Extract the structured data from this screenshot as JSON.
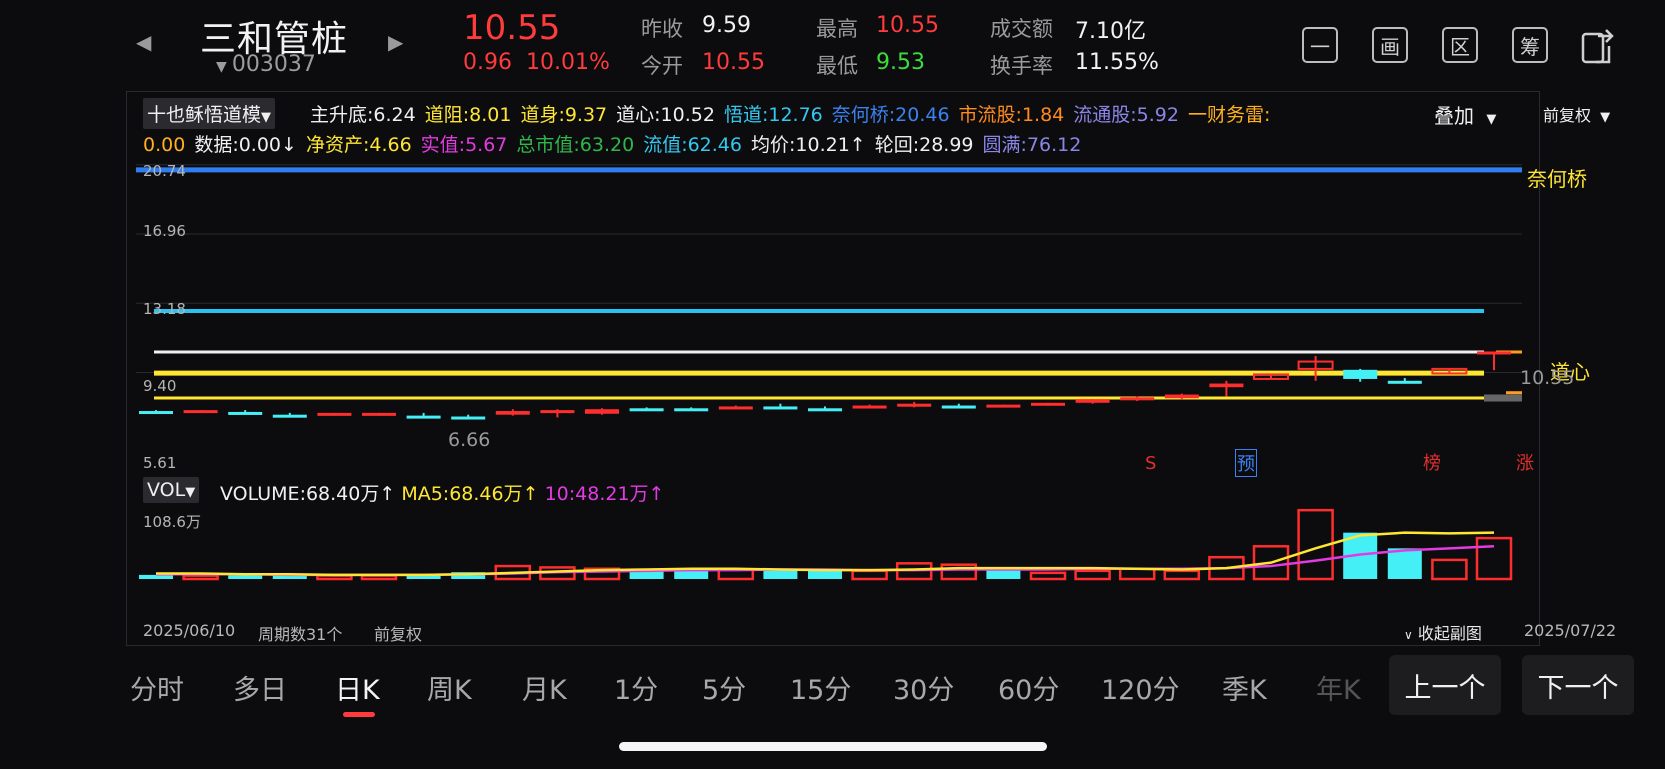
{
  "header": {
    "prev_icon": "chevron-left-icon",
    "next_icon": "chevron-right-icon",
    "stock_name": "三和管桩",
    "stock_code": "003037",
    "price": "10.55",
    "change": "0.96",
    "change_pct": "10.01%",
    "quotes": {
      "prev_close_label": "昨收",
      "prev_close": "9.59",
      "open_label": "今开",
      "open": "10.55",
      "high_label": "最高",
      "high": "10.55",
      "low_label": "最低",
      "low": "9.53",
      "amount_label": "成交额",
      "amount": "7.10亿",
      "turnover_label": "换手率",
      "turnover": "11.55%"
    },
    "tools": [
      "一",
      "画",
      "区",
      "筹"
    ],
    "share_icon": "share-icon"
  },
  "indicator": {
    "selector": "十也稣悟道模",
    "overlay": "叠加",
    "adjust": "前复权",
    "items": [
      {
        "text": "主升底:6.24",
        "color": "#f0f0f0"
      },
      {
        "text": "道阻:8.01",
        "color": "#ffe633"
      },
      {
        "text": "道身:9.37",
        "color": "#ffe633"
      },
      {
        "text": "道心:10.52",
        "color": "#f0f0f0"
      },
      {
        "text": "悟道:12.76",
        "color": "#34c8f0"
      },
      {
        "text": "奈何桥:20.46",
        "color": "#3a82f0"
      },
      {
        "text": "市流股:1.84",
        "color": "#ff8a1f"
      },
      {
        "text": "流通股:5.92",
        "color": "#8a86e8"
      },
      {
        "text": "一财务雷:",
        "color": "#ffb01f"
      }
    ],
    "items2": [
      {
        "text": "0.00",
        "color": "#ffb01f"
      },
      {
        "text": "数据:0.00↓",
        "color": "#f0f0f0"
      },
      {
        "text": "净资产:4.66",
        "color": "#ffe633"
      },
      {
        "text": "实值:5.67",
        "color": "#e23be2"
      },
      {
        "text": "总市值:63.20",
        "color": "#2fb84a"
      },
      {
        "text": "流值:62.46",
        "color": "#34c8f0"
      },
      {
        "text": "均价:10.21↑",
        "color": "#f0f0f0"
      },
      {
        "text": "轮回:28.99",
        "color": "#f0f0f0"
      },
      {
        "text": "圆满:76.12",
        "color": "#8a86e8"
      }
    ]
  },
  "price_chart": {
    "y_ticks": [
      "20.74",
      "16.96",
      "13.18",
      "9.40",
      "5.61"
    ],
    "label_naihe": "奈何桥",
    "label_daoxin": "道心",
    "last_price_label": "10.55",
    "min_label": "6.66",
    "markers": [
      {
        "text": "S",
        "color": "#e0302e"
      },
      {
        "text": "预",
        "color": "#3a82f0"
      },
      {
        "text": "榜",
        "color": "#e0302e"
      },
      {
        "text": "涨",
        "color": "#e0302e"
      }
    ]
  },
  "volume": {
    "selector": "VOL",
    "vol_label": "VOLUME:68.40万↑",
    "ma5_label": "MA5:68.46万↑",
    "ma10_label": "10:48.21万↑",
    "max_label": "108.6万"
  },
  "footer": {
    "start_date": "2025/06/10",
    "period_count": "周期数31个",
    "adjust": "前复权",
    "collapse": "收起副图",
    "end_date": "2025/07/22"
  },
  "tabs": [
    "分时",
    "多日",
    "日K",
    "周K",
    "月K",
    "1分",
    "5分",
    "15分",
    "30分",
    "60分",
    "120分",
    "季K",
    "年K"
  ],
  "active_tab": "日K",
  "prev_button": "上一个",
  "next_button": "下一个",
  "chart_data": {
    "type": "candlestick",
    "candles": [
      {
        "o": 7.3,
        "c": 7.3,
        "h": 7.35,
        "l": 7.2,
        "up": false
      },
      {
        "o": 7.35,
        "c": 7.25,
        "h": 7.35,
        "l": 7.2,
        "up": true
      },
      {
        "o": 7.25,
        "c": 7.25,
        "h": 7.35,
        "l": 7.15,
        "up": false
      },
      {
        "o": 7.1,
        "c": 7.1,
        "h": 7.2,
        "l": 7.0,
        "up": false
      },
      {
        "o": 7.2,
        "c": 7.05,
        "h": 7.2,
        "l": 7.05,
        "up": true
      },
      {
        "o": 7.2,
        "c": 7.05,
        "h": 7.2,
        "l": 7.05,
        "up": true
      },
      {
        "o": 7.05,
        "c": 7.05,
        "h": 7.2,
        "l": 6.9,
        "up": false
      },
      {
        "o": 7.0,
        "c": 7.0,
        "h": 7.1,
        "l": 6.95,
        "up": false
      },
      {
        "o": 7.3,
        "c": 7.1,
        "h": 7.4,
        "l": 7.05,
        "up": true
      },
      {
        "o": 7.35,
        "c": 7.2,
        "h": 7.4,
        "l": 6.95,
        "up": true
      },
      {
        "o": 7.4,
        "c": 7.15,
        "h": 7.45,
        "l": 7.1,
        "up": true
      },
      {
        "o": 7.45,
        "c": 7.45,
        "h": 7.5,
        "l": 7.35,
        "up": false
      },
      {
        "o": 7.45,
        "c": 7.45,
        "h": 7.5,
        "l": 7.35,
        "up": false
      },
      {
        "o": 7.55,
        "c": 7.45,
        "h": 7.6,
        "l": 7.45,
        "up": true
      },
      {
        "o": 7.55,
        "c": 7.5,
        "h": 7.7,
        "l": 7.4,
        "up": false
      },
      {
        "o": 7.45,
        "c": 7.45,
        "h": 7.55,
        "l": 7.4,
        "up": false
      },
      {
        "o": 7.6,
        "c": 7.45,
        "h": 7.65,
        "l": 7.45,
        "up": true
      },
      {
        "o": 7.7,
        "c": 7.6,
        "h": 7.8,
        "l": 7.5,
        "up": true
      },
      {
        "o": 7.6,
        "c": 7.6,
        "h": 7.7,
        "l": 7.5,
        "up": false
      },
      {
        "o": 7.65,
        "c": 7.55,
        "h": 7.65,
        "l": 7.5,
        "up": true
      },
      {
        "o": 7.75,
        "c": 7.6,
        "h": 7.75,
        "l": 7.6,
        "up": true
      },
      {
        "o": 7.95,
        "c": 7.75,
        "h": 7.95,
        "l": 7.7,
        "up": true
      },
      {
        "o": 8.05,
        "c": 7.9,
        "h": 8.1,
        "l": 7.85,
        "up": true
      },
      {
        "o": 8.2,
        "c": 8.0,
        "h": 8.25,
        "l": 7.95,
        "up": true
      },
      {
        "o": 8.8,
        "c": 8.6,
        "h": 8.95,
        "l": 8.1,
        "up": true
      },
      {
        "o": 9.3,
        "c": 9.05,
        "h": 9.3,
        "l": 9.0,
        "up": true
      },
      {
        "o": 10.0,
        "c": 9.6,
        "h": 10.3,
        "l": 8.95,
        "up": true
      },
      {
        "o": 9.55,
        "c": 9.05,
        "h": 9.6,
        "l": 8.9,
        "up": false
      },
      {
        "o": 8.95,
        "c": 8.95,
        "h": 9.1,
        "l": 8.8,
        "up": false
      },
      {
        "o": 9.6,
        "c": 9.35,
        "h": 9.65,
        "l": 9.3,
        "up": true
      },
      {
        "o": 10.55,
        "c": 10.55,
        "h": 10.55,
        "l": 9.53,
        "up": true
      }
    ],
    "volume": [
      6,
      5,
      6,
      5,
      5,
      5,
      6,
      10,
      19,
      17,
      15,
      13,
      13,
      14,
      13,
      12,
      12,
      23,
      21,
      13,
      9,
      12,
      15,
      12,
      32,
      48,
      101,
      68,
      45,
      28,
      60
    ],
    "volume_up": [
      false,
      true,
      false,
      false,
      true,
      true,
      false,
      false,
      true,
      true,
      true,
      false,
      false,
      true,
      false,
      false,
      true,
      true,
      true,
      false,
      true,
      true,
      true,
      true,
      true,
      true,
      true,
      false,
      false,
      true,
      true
    ],
    "ma5": [
      8,
      8,
      7,
      7,
      6,
      6,
      6,
      7,
      9,
      11,
      13,
      14,
      15,
      15,
      14,
      13,
      13,
      14,
      16,
      16,
      16,
      16,
      15,
      14,
      16,
      24,
      45,
      64,
      68,
      67,
      68
    ],
    "ma10": [
      7,
      7,
      7,
      6,
      6,
      6,
      6,
      7,
      8,
      10,
      11,
      12,
      13,
      13,
      14,
      14,
      13,
      13,
      14,
      14,
      14,
      15,
      15,
      15,
      16,
      19,
      27,
      36,
      42,
      45,
      48
    ],
    "levels": {
      "naihe": 20.46,
      "wudao": 12.76,
      "daoxin": 10.52,
      "daoshen": 9.37,
      "daozu": 8.01
    },
    "price_range": [
      5.61,
      21.0
    ],
    "volume_max": 108.6
  }
}
